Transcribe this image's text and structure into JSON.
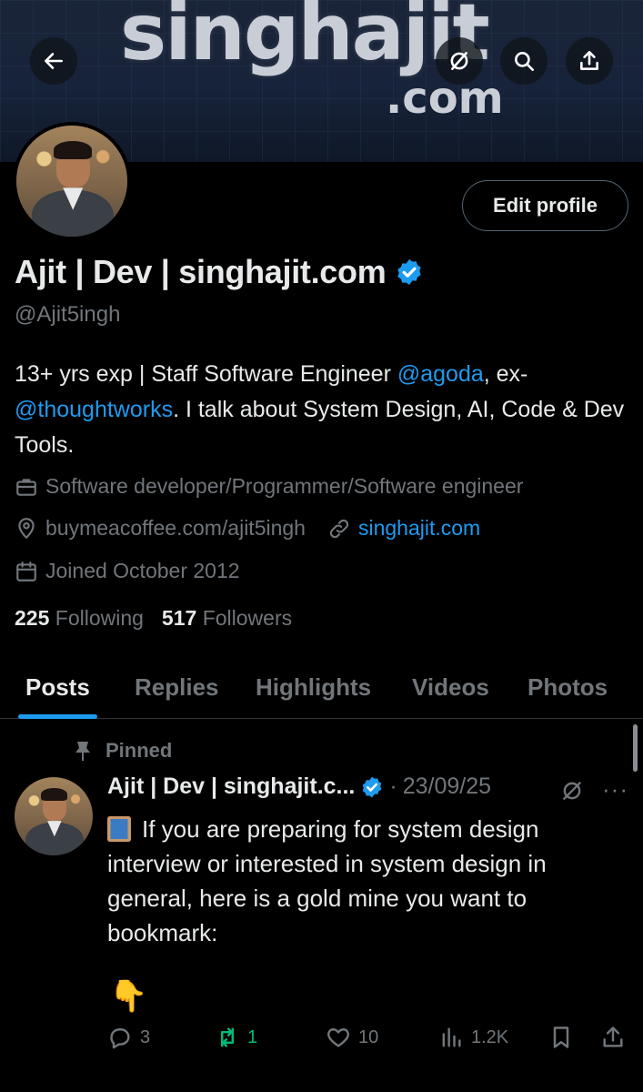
{
  "header": {
    "banner_text": "singhajit",
    "banner_subtext": ".com",
    "back_icon": "arrow-left-icon",
    "grok_icon": "slashed-circle-icon",
    "search_icon": "search-icon",
    "share_icon": "share-icon"
  },
  "profile": {
    "edit_label": "Edit profile",
    "name": "Ajit | Dev | singhajit.com",
    "handle": "@Ajit5ingh",
    "bio": {
      "part1": "13+ yrs exp | Staff Software Engineer ",
      "mention1": "@agoda",
      "part2": ", ex-",
      "mention2": "@thoughtworks",
      "part3": ". I talk about System Design, AI, Code & Dev Tools."
    },
    "profession": "Software developer/Programmer/Software engineer",
    "location": "buymeacoffee.com/ajit5ingh",
    "website": "singhajit.com",
    "joined": "Joined October 2012",
    "following_count": "225",
    "following_label": "Following",
    "followers_count": "517",
    "followers_label": "Followers"
  },
  "tabs": [
    {
      "label": "Posts",
      "active": true
    },
    {
      "label": "Replies"
    },
    {
      "label": "Highlights"
    },
    {
      "label": "Videos"
    },
    {
      "label": "Photos"
    }
  ],
  "post": {
    "pinned_label": "Pinned",
    "author": "Ajit | Dev | singhajit.c...",
    "date": "23/09/25",
    "separator": "·",
    "more": "···",
    "text": "If you are preparing for system design interview or interested in system design in general, here is a gold mine you want to bookmark:",
    "pointing_emoji": "👇",
    "replies": "3",
    "reposts": "1",
    "likes": "10",
    "views": "1.2K"
  },
  "colors": {
    "accent": "#1d9bf0",
    "repost": "#00ba7c",
    "muted": "#71767b",
    "text": "#e7e9ea",
    "background": "#000000"
  }
}
